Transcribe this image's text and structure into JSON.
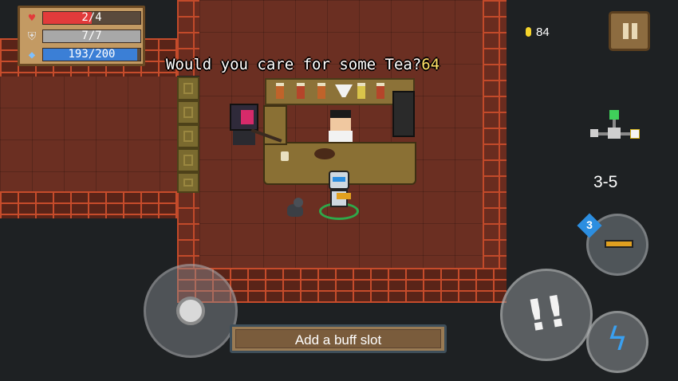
{
  "hud": {
    "health": {
      "icon": "heart-icon",
      "text": "2/4",
      "fraction": 0.5,
      "color": "#e23b3b"
    },
    "armor": {
      "icon": "shield-icon",
      "text": "7/7",
      "fraction": 1.0,
      "color": "#a8a8a8"
    },
    "energy": {
      "icon": "energy-diamond-icon",
      "text": "193/200",
      "fraction": 0.965,
      "color": "#3b7fd6"
    },
    "coins": "84",
    "pause_icon": "pause-icon",
    "level": "3-5",
    "weapon_badge": "3"
  },
  "dialog": {
    "text": "Would you care for some Tea?",
    "number": "64"
  },
  "buttons": {
    "buff_slot": "Add a buff slot"
  }
}
